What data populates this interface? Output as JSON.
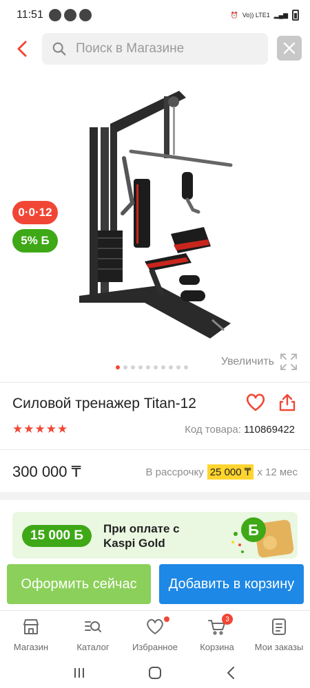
{
  "status_bar": {
    "time": "11:51",
    "network": "Vo)) LTE1"
  },
  "header": {
    "search_placeholder": "Поиск в Магазине"
  },
  "gallery": {
    "installment_badge": "0·0·12",
    "bonus_badge": "5% Б",
    "dots_total": 10,
    "active_dot": 1,
    "zoom_label": "Увеличить"
  },
  "product": {
    "title": "Силовой тренажер Titan-12",
    "rating_stars": "★★★★★",
    "sku_label": "Код товара:",
    "sku_value": "110869422"
  },
  "price": {
    "value": "300 000 ₸",
    "installment_prefix": "В рассрочку",
    "installment_amount": "25 000 ₸",
    "installment_suffix": "х 12 мес"
  },
  "kaspi_gold": {
    "bonus": "15 000 Б",
    "line1": "При оплате с",
    "line2": "Kaspi Gold"
  },
  "actions": {
    "checkout_label": "Оформить сейчас",
    "cart_label": "Добавить в корзину"
  },
  "nav": {
    "items": [
      {
        "label": "Магазин",
        "icon": "store-icon"
      },
      {
        "label": "Каталог",
        "icon": "catalog-icon"
      },
      {
        "label": "Избранное",
        "icon": "heart-icon"
      },
      {
        "label": "Корзина",
        "icon": "cart-icon",
        "badge": "3"
      },
      {
        "label": "Мои заказы",
        "icon": "orders-icon"
      }
    ]
  },
  "colors": {
    "accent": "#f14635",
    "green": "#3ea816",
    "blue": "#1d88e5",
    "yellow": "#ffd42e"
  }
}
